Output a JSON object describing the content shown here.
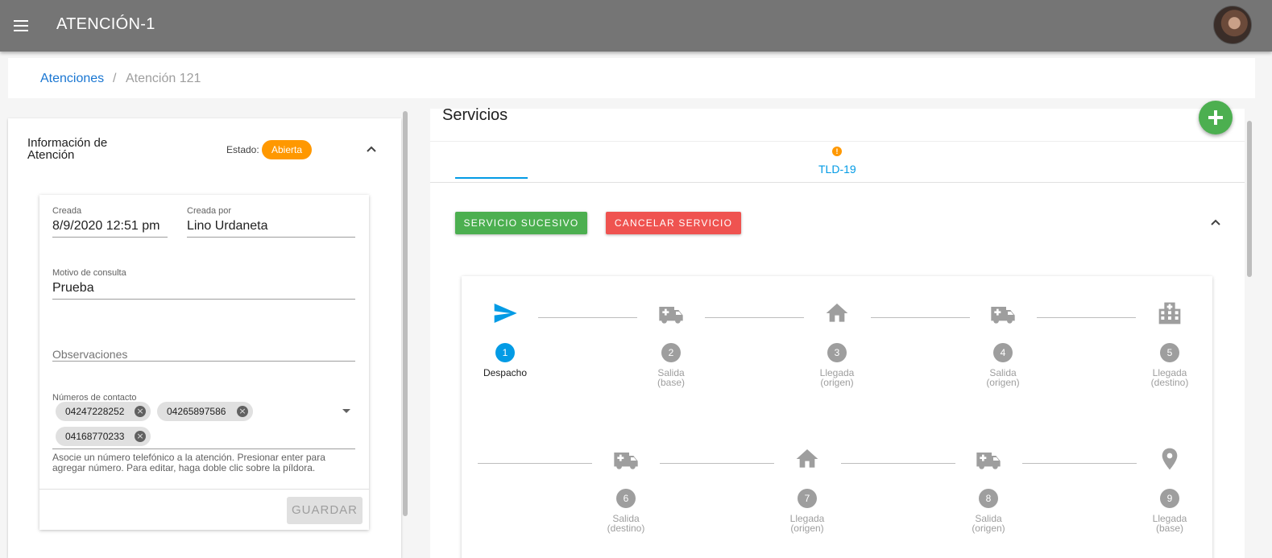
{
  "appbar": {
    "title": "ATENCIÓN-1",
    "menu_icon": "menu-icon",
    "avatar_icon": "user-avatar"
  },
  "breadcrumb": {
    "parent": "Atenciones",
    "separator": "/",
    "current": "Atención 121"
  },
  "info": {
    "title": "Información de Atención",
    "estado_label": "Estado:",
    "estado_value": "Abierta",
    "estado_color": "#ff9800",
    "form": {
      "creada_label": "Creada",
      "creada_value": "8/9/2020 12:51 pm",
      "creada_por_label": "Creada por",
      "creada_por_value": "Lino Urdaneta",
      "motivo_label": "Motivo de consulta",
      "motivo_value": "Prueba",
      "observaciones_placeholder": "Observaciones",
      "contactos_label": "Números de contacto",
      "contactos": [
        "04247228252",
        "04265897586",
        "04168770233"
      ],
      "hint": "Asocie un número telefónico a la atención. Presionar enter para agregar número. Para editar, haga doble clic sobre la píldora.",
      "guardar_label": "GUARDAR"
    }
  },
  "services": {
    "title": "Servicios",
    "tab_label": "TLD-19",
    "tab_warning": "!",
    "sucesivo_label": "SERVICIO SUCESIVO",
    "cancelar_label": "CANCELAR SERVICIO",
    "steps": [
      {
        "num": "1",
        "label": "Despacho",
        "label2": "",
        "icon": "send-icon",
        "active": true
      },
      {
        "num": "2",
        "label": "Salida",
        "label2": "(base)",
        "icon": "ambulance-icon",
        "active": false
      },
      {
        "num": "3",
        "label": "Llegada",
        "label2": "(origen)",
        "icon": "home-icon",
        "active": false
      },
      {
        "num": "4",
        "label": "Salida",
        "label2": "(origen)",
        "icon": "ambulance-icon",
        "active": false
      },
      {
        "num": "5",
        "label": "Llegada",
        "label2": "(destino)",
        "icon": "hospital-icon",
        "active": false
      },
      {
        "num": "6",
        "label": "Salida",
        "label2": "(destino)",
        "icon": "ambulance-icon",
        "active": false
      },
      {
        "num": "7",
        "label": "Llegada",
        "label2": "(origen)",
        "icon": "home-icon",
        "active": false
      },
      {
        "num": "8",
        "label": "Salida",
        "label2": "(origen)",
        "icon": "ambulance-icon",
        "active": false
      },
      {
        "num": "9",
        "label": "Llegada",
        "label2": "(base)",
        "icon": "location-pin-icon",
        "active": false
      }
    ]
  },
  "colors": {
    "accent": "#039be5",
    "success": "#4caf50",
    "danger": "#ef5350",
    "appbar": "#757575"
  }
}
